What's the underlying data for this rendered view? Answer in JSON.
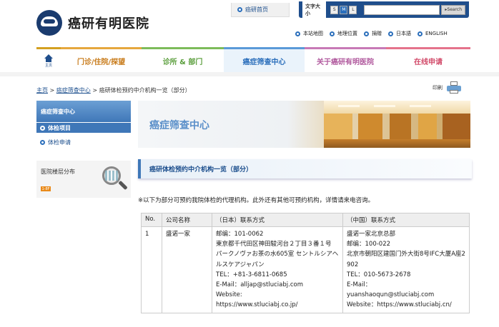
{
  "site": {
    "logo_text": "癌研有明医院",
    "home_tab": "癌研首页"
  },
  "font_size": {
    "label": "文字大小",
    "options": [
      "S",
      "M",
      "L"
    ],
    "selected": "M",
    "search_placeholder": "",
    "search_button": "▸Search"
  },
  "util_links": [
    "本站地图",
    "地理位置",
    "捐赠",
    "日本語",
    "ENGLISH"
  ],
  "nav": {
    "home_label": "主页",
    "items": [
      "门诊/住院/探望",
      "诊所 & 部门",
      "癌症筛查中心",
      "关于癌研有明医院",
      "在线申请"
    ],
    "active_index": 2
  },
  "breadcrumb": {
    "items": [
      "主页",
      "癌症筛查中心"
    ],
    "current": "癌研体检预约中介机构一览（部分）",
    "separator": ">"
  },
  "print_label": "印刷",
  "sidebar": {
    "header": "癌症筛查中心",
    "items": [
      {
        "label": "体检项目",
        "active": true
      },
      {
        "label": "体检申请",
        "active": false
      }
    ],
    "floor_title": "医院楼层分布",
    "floor_badge": "1-8F"
  },
  "banner": {
    "title": "癌症筛查中心"
  },
  "section": {
    "title": "癌研体检预约中介机构一览（部分）",
    "note": "※以下为部分可预约我院体检的代理机构。此外还有其他可预约机构，详情请来电咨询。"
  },
  "table": {
    "headers": [
      "No.",
      "公司名称",
      "（日本）联系方式",
      "（中国）联系方式"
    ],
    "rows": [
      {
        "no": "1",
        "company": "盛诺一家",
        "japan": [
          "邮编：101-0062",
          "東京都千代田区神田駿河台２丁目３番１号",
          "パークノヴァお茶の水605室 セントルシアヘルスケアジャパン",
          "TEL：+81-3-6811-0685",
          "E-Mail：alljap@stluciabj.com",
          "Website:",
          "https://www.stluciabj.co.jp/"
        ],
        "china": [
          "盛诺一家北京总部",
          "邮编：100-022",
          "北京市朝阳区建国门外大街8号IFC大厦A座2902",
          "TEL：010-5673-2678",
          "E-Mail：",
          "yuanshaoqun@stluciabj.com",
          "Website：https://www.stluciabj.cn/"
        ]
      }
    ]
  },
  "colors": {
    "brand_blue": "#1f4e8c",
    "accent_blue": "#3f77b8",
    "nav_orange": "#e6a73d",
    "nav_green": "#7dbb5a",
    "nav_purple": "#c779b6",
    "nav_pink": "#e5728b"
  }
}
